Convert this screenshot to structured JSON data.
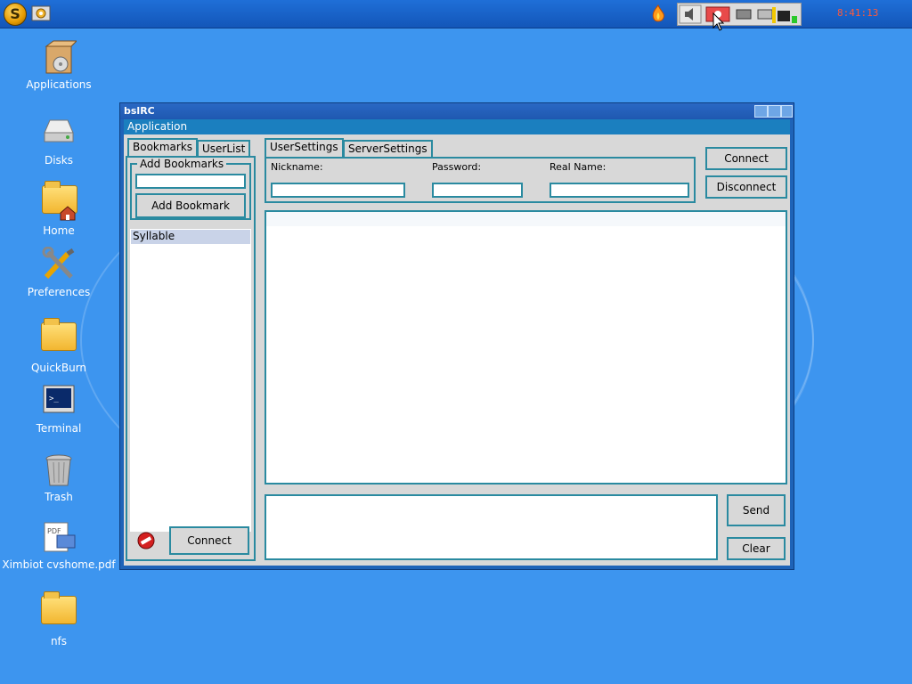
{
  "taskbar": {
    "clock": "8:41:13",
    "logo_icon": "syllable-logo-icon",
    "tray_icons": [
      "flame-icon",
      "volume-icon",
      "camera-icon",
      "cpu-icon",
      "drive-icon",
      "network-icon"
    ]
  },
  "desktop": {
    "icons": [
      {
        "label": "Applications",
        "icon": "applications-box-icon"
      },
      {
        "label": "Disks",
        "icon": "disk-icon"
      },
      {
        "label": "Home",
        "icon": "home-folder-icon"
      },
      {
        "label": "Preferences",
        "icon": "preferences-tools-icon"
      },
      {
        "label": "QuickBurn",
        "icon": "folder-icon"
      },
      {
        "label": "Terminal",
        "icon": "terminal-icon"
      },
      {
        "label": "Trash",
        "icon": "trash-icon"
      },
      {
        "label": "Ximbiot cvshome.pdf",
        "icon": "pdf-icon"
      },
      {
        "label": "nfs",
        "icon": "folder-icon"
      }
    ]
  },
  "window": {
    "title": "bslRC",
    "menu": "Application",
    "left_tabs": [
      "Bookmarks",
      "UserList"
    ],
    "add_bookmarks": {
      "group_label": "Add Bookmarks",
      "input_value": "",
      "button": "Add Bookmark"
    },
    "bookmark_list": [
      "Syllable"
    ],
    "left_connect": "Connect",
    "right_tabs": [
      "UserSettings",
      "ServerSettings"
    ],
    "user_settings": {
      "nickname_label": "Nickname:",
      "password_label": "Password:",
      "realname_label": "Real Name:",
      "nickname_value": "",
      "password_value": "",
      "realname_value": ""
    },
    "connect": "Connect",
    "disconnect": "Disconnect",
    "send": "Send",
    "clear": "Clear",
    "message_value": ""
  }
}
